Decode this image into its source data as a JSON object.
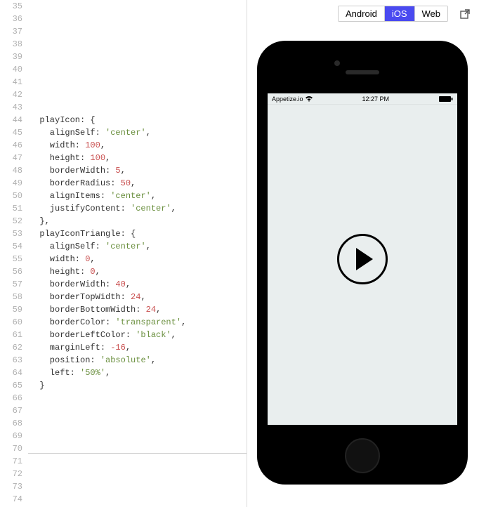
{
  "editor": {
    "startLine": 35,
    "endLine": 74,
    "lines": [
      "",
      "",
      "",
      "",
      "",
      "",
      "",
      "",
      "",
      "  playIcon: {",
      "    alignSelf: 'center',",
      "    width: 100,",
      "    height: 100,",
      "    borderWidth: 5,",
      "    borderRadius: 50,",
      "    alignItems: 'center',",
      "    justifyContent: 'center',",
      "  },",
      "  playIconTriangle: {",
      "    alignSelf: 'center',",
      "    width: 0,",
      "    height: 0,",
      "    borderWidth: 40,",
      "    borderTopWidth: 24,",
      "    borderBottomWidth: 24,",
      "    borderColor: 'transparent',",
      "    borderLeftColor: 'black',",
      "    marginLeft: -16,",
      "    position: 'absolute',",
      "    left: '50%',",
      "  }",
      "",
      "",
      "",
      "",
      "",
      "",
      "",
      "",
      ""
    ]
  },
  "platforms": {
    "tabs": [
      "Android",
      "iOS",
      "Web"
    ],
    "active": "iOS"
  },
  "statusbar": {
    "carrier": "Appetize.io",
    "time": "12:27 PM"
  }
}
